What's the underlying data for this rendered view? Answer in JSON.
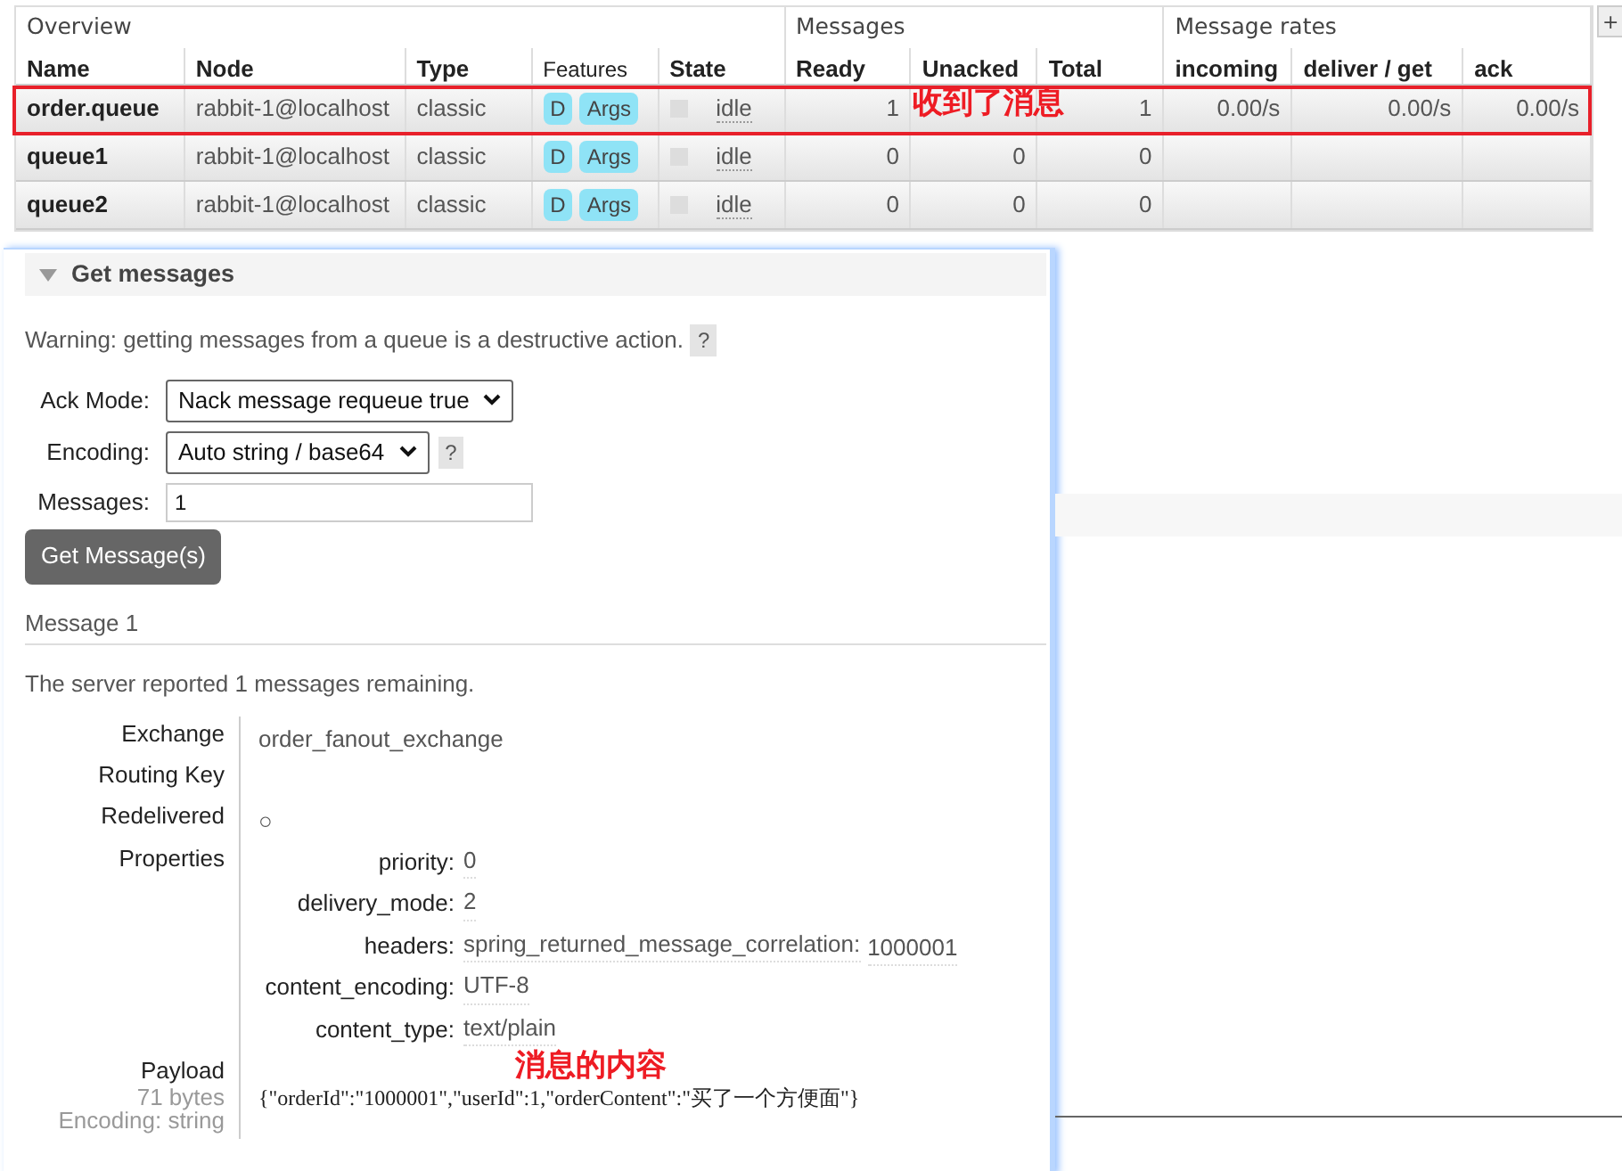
{
  "table": {
    "groups": [
      {
        "label": "Overview",
        "columns": [
          "Name",
          "Node",
          "Type",
          "Features",
          "State"
        ]
      },
      {
        "label": "Messages",
        "columns": [
          "Ready",
          "Unacked",
          "Total"
        ]
      },
      {
        "label": "Message rates",
        "columns": [
          "incoming",
          "deliver / get",
          "ack"
        ]
      }
    ],
    "add_button": "+",
    "rows": [
      {
        "cells": [
          "order.queue",
          "rabbit-1@localhost",
          "classic",
          null,
          "idle",
          "1",
          null,
          "1",
          "0.00/s",
          "0.00/s",
          "0.00/s"
        ],
        "features": [
          "D",
          "Args"
        ]
      },
      {
        "cells": [
          "queue1",
          "rabbit-1@localhost",
          "classic",
          null,
          "idle",
          "0",
          "0",
          "0"
        ],
        "features": [
          "D",
          "Args"
        ]
      },
      {
        "cells": [
          "queue2",
          "rabbit-1@localhost",
          "classic",
          null,
          "idle",
          "0",
          "0",
          "0"
        ],
        "features": [
          "D",
          "Args"
        ]
      }
    ]
  },
  "annotations": [
    {
      "text": "收到了消息"
    },
    {
      "text": "消息的内容"
    }
  ],
  "panel": {
    "title": "Get messages",
    "expanded": true,
    "warning": "Warning: getting messages from a queue is a destructive action.",
    "help": "?",
    "fields": [
      {
        "kind": "select",
        "label": "Ack Mode:",
        "value": "Nack message requeue true"
      },
      {
        "kind": "select",
        "label": "Encoding:",
        "value": "Auto string / base64",
        "help": "?"
      },
      {
        "kind": "input",
        "label": "Messages:",
        "value": "1"
      }
    ],
    "button": "Get Message(s)",
    "message_heading": "Message 1",
    "remaining": "The server reported 1 messages remaining.",
    "details": [
      {
        "kind": "text",
        "label": "Exchange",
        "value": "order_fanout_exchange"
      },
      {
        "kind": "text",
        "label": "Routing Key"
      },
      {
        "kind": "text",
        "label": "Redelivered",
        "value": "○"
      },
      {
        "kind": "properties",
        "label": "Properties",
        "properties": [
          {
            "key": "priority:",
            "value": "0"
          },
          {
            "key": "delivery_mode:",
            "value": "2"
          },
          {
            "key": "headers:",
            "value": "spring_returned_message_correlation:",
            "sub_value": "1000001"
          },
          {
            "key": "content_encoding:",
            "value": "UTF-8"
          },
          {
            "key": "content_type:",
            "value": "text/plain"
          }
        ]
      },
      {
        "kind": "payload",
        "label": "Payload",
        "size": "71 bytes",
        "encoding": "Encoding: string",
        "value": "{\"orderId\":\"1000001\",\"userId\":1,\"orderContent\":\"买了一个方便面\"}"
      }
    ]
  }
}
